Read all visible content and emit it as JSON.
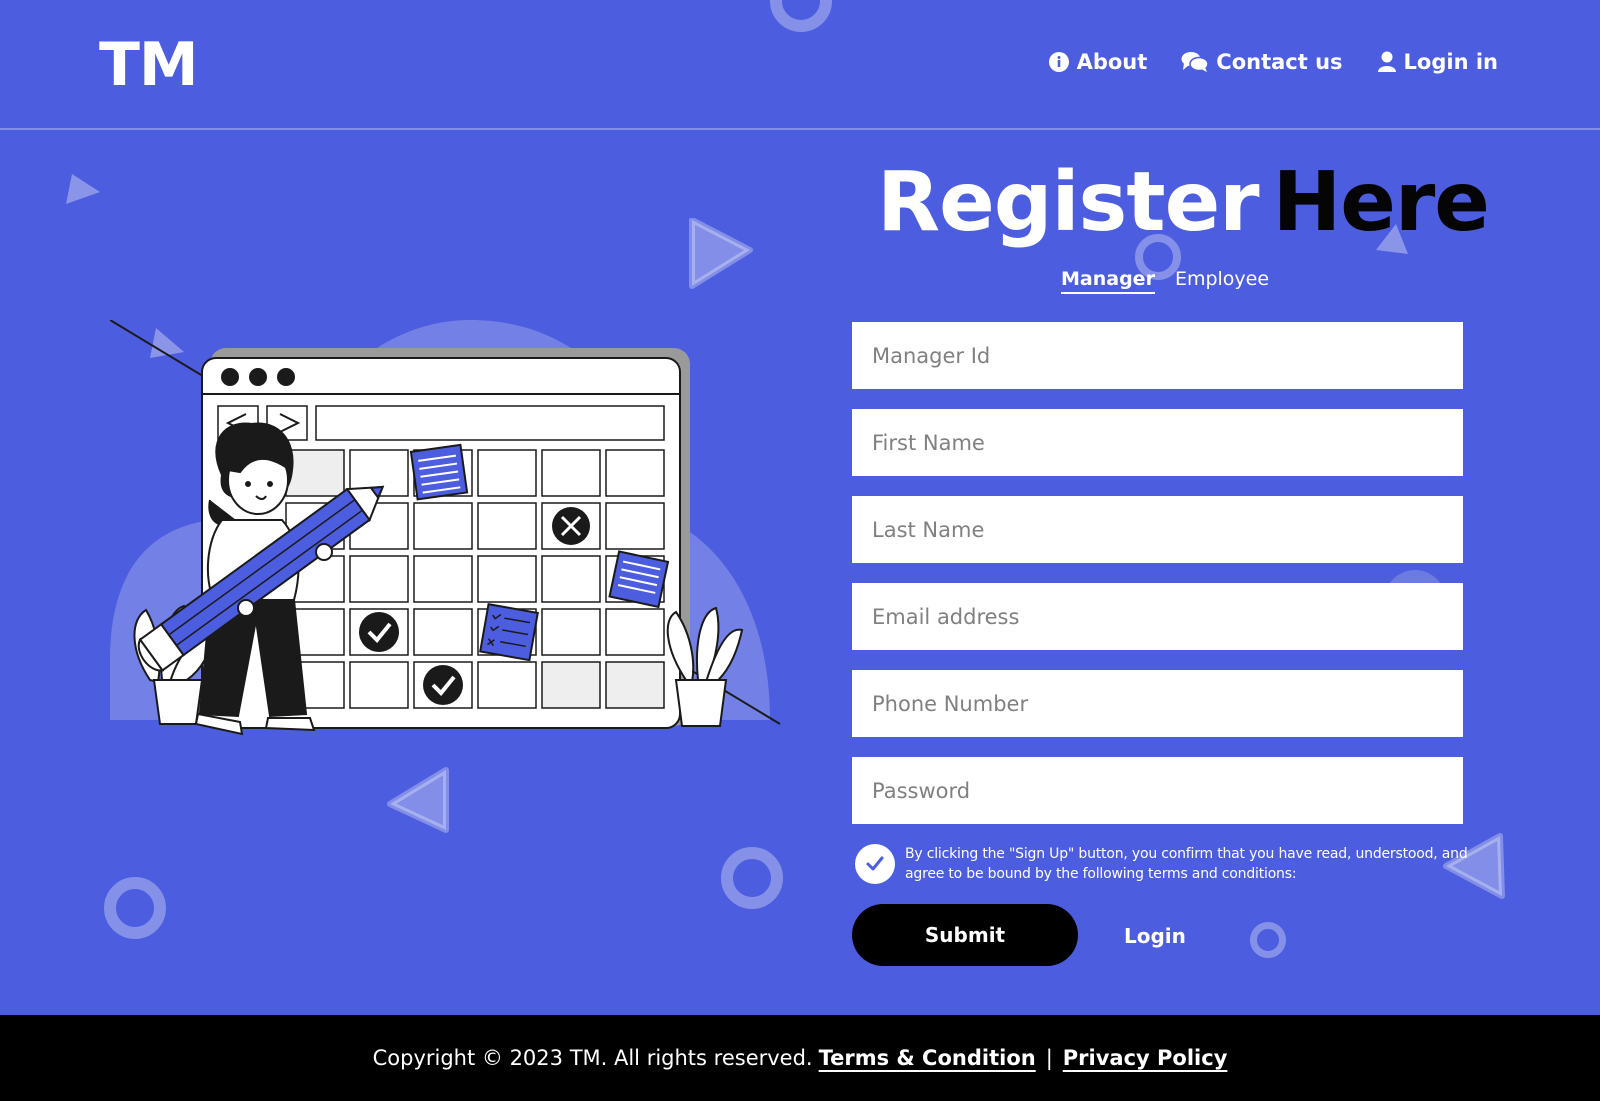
{
  "header": {
    "logo": "TM",
    "nav": [
      {
        "label": "About",
        "icon": "info-circle-icon"
      },
      {
        "label": "Contact us",
        "icon": "chat-bubbles-icon"
      },
      {
        "label": "Login in",
        "icon": "user-icon"
      }
    ]
  },
  "main": {
    "title_part1": "Register",
    "title_part2": "Here",
    "tabs": [
      {
        "label": "Manager",
        "active": true
      },
      {
        "label": "Employee",
        "active": false
      }
    ],
    "fields": [
      {
        "placeholder": "Manager Id",
        "value": ""
      },
      {
        "placeholder": "First Name",
        "value": ""
      },
      {
        "placeholder": "Last Name",
        "value": ""
      },
      {
        "placeholder": "Email address",
        "value": ""
      },
      {
        "placeholder": "Phone Number",
        "value": ""
      },
      {
        "placeholder": "Password",
        "value": ""
      }
    ],
    "terms_text": "By clicking the \"Sign Up\" button, you confirm that you have read, understood, and agree to be bound by the following terms and conditions:",
    "terms_checked": true,
    "submit_label": "Submit",
    "login_label": "Login"
  },
  "footer": {
    "copyright": "Copyright ©  2023 TM. All rights reserved.",
    "terms_link": "Terms & Condition",
    "separator": "|",
    "privacy_link": "Privacy Policy"
  },
  "colors": {
    "background": "#4c5ddf",
    "accent_dark": "#000000",
    "text": "#ffffff"
  }
}
